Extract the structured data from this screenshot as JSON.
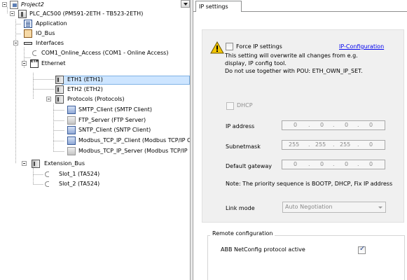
{
  "tree": {
    "items": [
      {
        "label": "Project2"
      },
      {
        "label": "PLC_AC500 (PM591-2ETH - TB523-2ETH)"
      },
      {
        "label": "Application"
      },
      {
        "label": "IO_Bus"
      },
      {
        "label": "Interfaces"
      },
      {
        "label": "COM1_Online_Access (COM1 - Online Access)"
      },
      {
        "label": "Ethernet"
      },
      {
        "label": "ETH1 (ETH1)"
      },
      {
        "label": "ETH2 (ETH2)"
      },
      {
        "label": "Protocols (Protocols)"
      },
      {
        "label": "SMTP_Client (SMTP Client)"
      },
      {
        "label": "FTP_Server (FTP Server)"
      },
      {
        "label": "SNTP_Client (SNTP Client)"
      },
      {
        "label": "Modbus_TCP_IP_Client (Modbus TCP/IP C"
      },
      {
        "label": "Modbus_TCP_IP_Server (Modbus TCP/IP"
      },
      {
        "label": "Extension_Bus"
      },
      {
        "label": "Slot_1 (TA524)"
      },
      {
        "label": "Slot_2 (TA524)"
      }
    ],
    "eth_icon_text": "ETH"
  },
  "editor": {
    "tab_label": "IP settings",
    "force_ip_label": "Force IP settings",
    "force_ip_checked": false,
    "ip_config_link": "IP-Configuration",
    "warning_line1": "This setting will overwrite all changes from e.g.",
    "warning_line2": "display, IP config tool.",
    "warning_line3": "Do not use together with POU: ETH_OWN_IP_SET.",
    "dhcp_label": "DHCP",
    "dhcp_checked": false,
    "ip_address_label": "IP address",
    "ip_address": [
      "0",
      "0",
      "0",
      "0"
    ],
    "subnetmask_label": "Subnetmask",
    "subnetmask": [
      "255",
      "255",
      "255",
      "0"
    ],
    "gateway_label": "Default gateway",
    "gateway": [
      "0",
      "0",
      "0",
      "0"
    ],
    "note": "Note: The priority sequence is BOOTP, DHCP, Fix IP address",
    "link_mode_label": "Link mode",
    "link_mode_value": "Auto Negotiation",
    "remote_title": "Remote configuration",
    "abb_netconfig_label": "ABB NetConfig protocol active",
    "abb_netconfig_checked": true,
    "ip_separator": "."
  },
  "colors": {
    "selection": "#cde5ff",
    "link": "#0000ee",
    "panel_bg": "#f0f0f0",
    "warning": "#f2c500"
  }
}
